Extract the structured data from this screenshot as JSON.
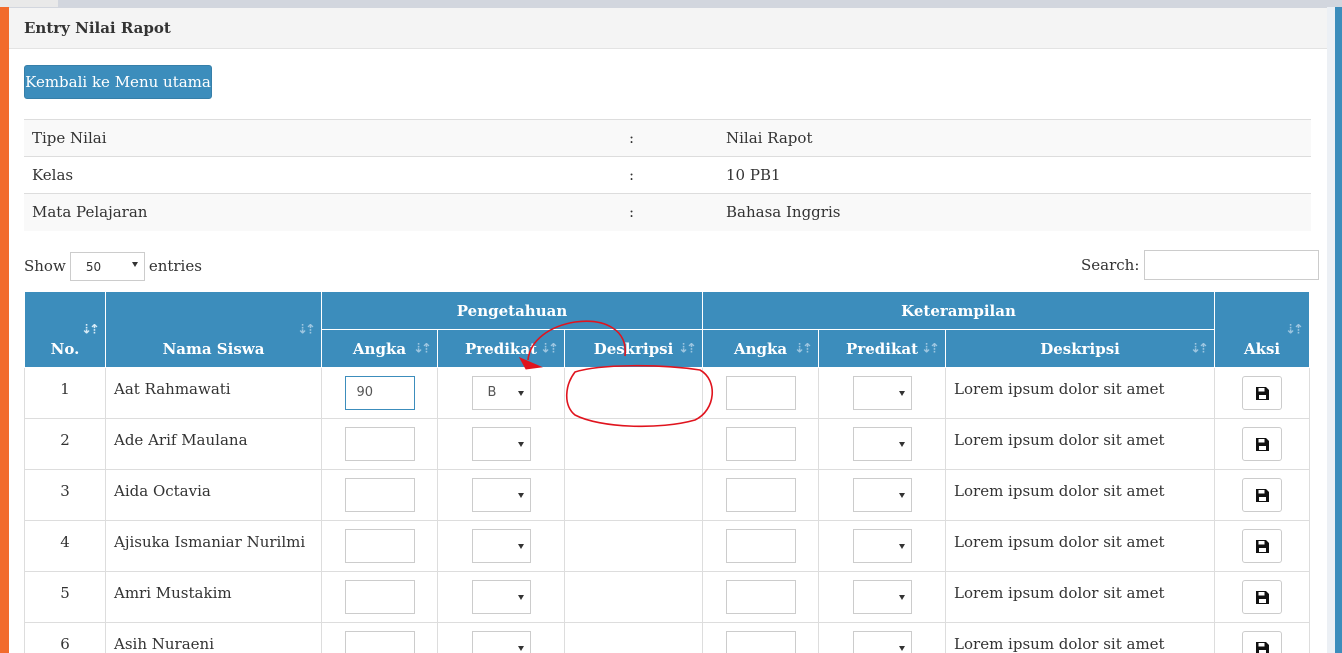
{
  "box": {
    "title": "Entry Nilai Rapot"
  },
  "back_button": "Kembali ke Menu utama",
  "info": [
    {
      "label": "Tipe Nilai",
      "sep": ":",
      "value": "Nilai Rapot"
    },
    {
      "label": "Kelas",
      "sep": ":",
      "value": "10 PB1"
    },
    {
      "label": "Mata Pelajaran",
      "sep": ":",
      "value": "Bahasa Inggris"
    }
  ],
  "table_controls": {
    "show_label": "Show",
    "entries_value": "50",
    "entries_label": "entries",
    "search_label": "Search:",
    "search_value": ""
  },
  "headers": {
    "no": "No.",
    "nama": "Nama Siswa",
    "pengetahuan": "Pengetahuan",
    "keterampilan": "Keterampilan",
    "aksi": "Aksi",
    "angka": "Angka",
    "predikat": "Predikat",
    "deskripsi": "Deskripsi"
  },
  "sort_icon": "sort-icon",
  "save_icon": "floppy-disk-icon",
  "rows": [
    {
      "no": "1",
      "nama": "Aat Rahmawati",
      "p_angka": "90",
      "p_predikat": "B",
      "p_deskripsi": "",
      "k_angka": "",
      "k_predikat": "",
      "k_deskripsi": "Lorem ipsum dolor sit amet"
    },
    {
      "no": "2",
      "nama": "Ade Arif Maulana",
      "p_angka": "",
      "p_predikat": "",
      "p_deskripsi": "",
      "k_angka": "",
      "k_predikat": "",
      "k_deskripsi": "Lorem ipsum dolor sit amet"
    },
    {
      "no": "3",
      "nama": "Aida Octavia",
      "p_angka": "",
      "p_predikat": "",
      "p_deskripsi": "",
      "k_angka": "",
      "k_predikat": "",
      "k_deskripsi": "Lorem ipsum dolor sit amet"
    },
    {
      "no": "4",
      "nama": "Ajisuka Ismaniar Nurilmi",
      "p_angka": "",
      "p_predikat": "",
      "p_deskripsi": "",
      "k_angka": "",
      "k_predikat": "",
      "k_deskripsi": "Lorem ipsum dolor sit amet"
    },
    {
      "no": "5",
      "nama": "Amri Mustakim",
      "p_angka": "",
      "p_predikat": "",
      "p_deskripsi": "",
      "k_angka": "",
      "k_predikat": "",
      "k_deskripsi": "Lorem ipsum dolor sit amet"
    },
    {
      "no": "6",
      "nama": "Asih Nuraeni",
      "p_angka": "",
      "p_predikat": "",
      "p_deskripsi": "",
      "k_angka": "",
      "k_predikat": "",
      "k_deskripsi": "Lorem ipsum dolor sit amet"
    }
  ],
  "colors": {
    "primary": "#3c8dbc",
    "accent_left": "#f26b2c",
    "annotation": "#e0141e"
  }
}
